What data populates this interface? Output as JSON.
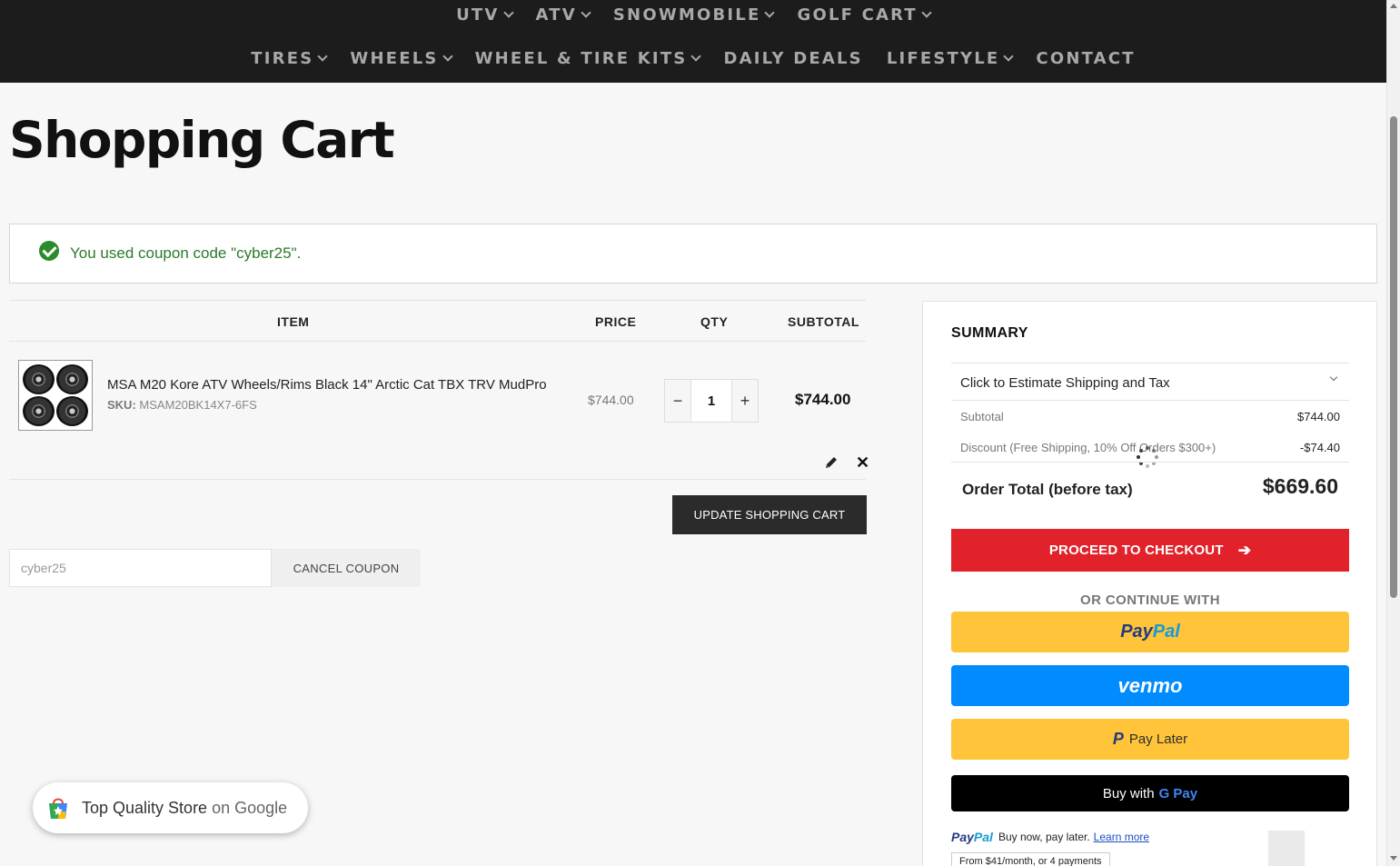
{
  "nav": {
    "row1": [
      "UTV",
      "ATV",
      "SNOWMOBILE",
      "GOLF CART"
    ],
    "row2": [
      "TIRES",
      "WHEELS",
      "WHEEL & TIRE KITS",
      "DAILY DEALS",
      "LIFESTYLE",
      "CONTACT"
    ],
    "row2_dropdown": [
      true,
      true,
      true,
      false,
      true,
      false
    ]
  },
  "page_title": "Shopping Cart",
  "coupon_message": "You used coupon code \"cyber25\".",
  "cart": {
    "headers": {
      "item": "ITEM",
      "price": "PRICE",
      "qty": "QTY",
      "subtotal": "SUBTOTAL"
    },
    "item": {
      "name": "MSA M20 Kore ATV Wheels/Rims Black 14\" Arctic Cat TBX TRV MudPro",
      "sku_label": "SKU:",
      "sku": "MSAM20BK14X7-6FS",
      "price": "$744.00",
      "qty": "1",
      "subtotal": "$744.00"
    },
    "update_label": "UPDATE SHOPPING CART",
    "coupon_value": "cyber25",
    "cancel_coupon_label": "CANCEL COUPON"
  },
  "summary": {
    "title": "SUMMARY",
    "estimate_label": "Click to Estimate Shipping and Tax",
    "subtotal_label": "Subtotal",
    "subtotal_value": "$744.00",
    "discount_label": "Discount (Free Shipping, 10% Off Orders $300+)",
    "discount_value": "-$74.40",
    "order_total_label": "Order Total (before tax)",
    "order_total_value": "$669.60",
    "checkout_label": "PROCEED TO CHECKOUT",
    "or_continue": "OR CONTINUE WITH",
    "paypal_part1": "Pay",
    "paypal_part2": "Pal",
    "venmo_label": "venmo",
    "paylater_label": "Pay Later",
    "gpay_prefix": "Buy with",
    "gpay_label": "G Pay",
    "pp_msg_logo1": "Pay",
    "pp_msg_logo2": "Pal",
    "pp_msg_text": "Buy now, pay later.",
    "pp_msg_link": "Learn more",
    "pp_msg_sub": "From $41/month, or 4 payments"
  },
  "google_badge": {
    "text1": "Top Quality Store",
    "text2": "on Google"
  },
  "colors": {
    "checkout_red": "#e1222b",
    "paypal_yellow": "#ffc439",
    "venmo_blue": "#008cff",
    "nav_bg": "#1c1c1c",
    "success_green": "#2a7a2a"
  }
}
